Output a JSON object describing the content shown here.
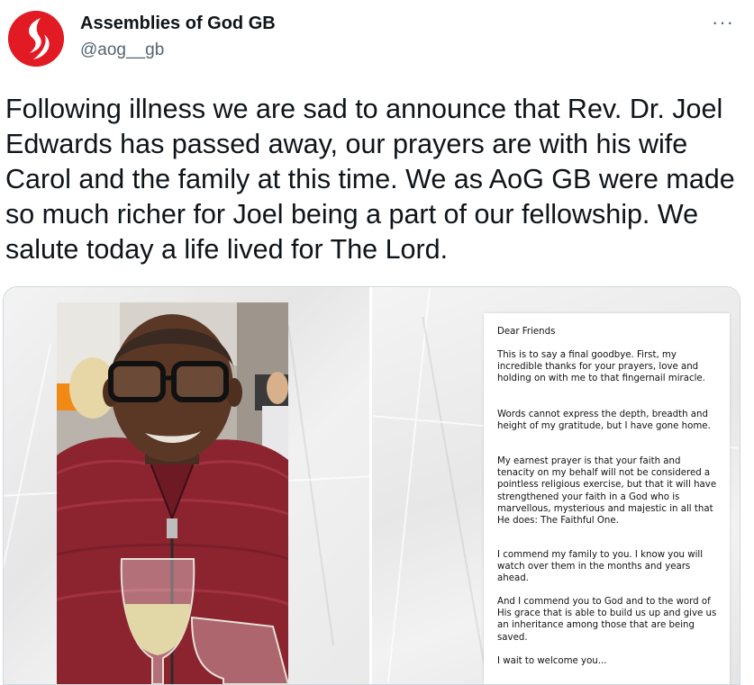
{
  "account": {
    "name": "Assemblies of God GB",
    "handle": "@aog__gb",
    "avatar_icon": "aog-flame-logo",
    "brand_color": "#e21a23"
  },
  "menu": {
    "more_label": "···",
    "icon": "more-dots-icon"
  },
  "tweet": {
    "text": "Following illness we are sad to announce that Rev. Dr. Joel Edwards has passed away, our prayers are with his wife Carol and the family at this time. We as AoG GB were made so much richer for Joel being a part of our fellowship. We salute today a life lived for The Lord."
  },
  "media": {
    "photo_icon": "portrait-photo",
    "letter": {
      "greeting": "Dear Friends",
      "paragraphs": [
        "This is to say a final goodbye. First, my incredible thanks for your prayers, love and holding on with me to that fingernail miracle.",
        "Words cannot express the depth, breadth and height of my gratitude, but I have gone home.",
        "My earnest prayer is that your faith and tenacity on my behalf will not be considered a pointless religious exercise, but that it will have strengthened your faith in a God who is marvellous, mysterious and majestic in all that He does: The Faithful One.",
        "I commend my family to you. I know you will watch over them in the months and years ahead.",
        "And I commend you to God and to the word of His grace that is able to build us up and give us an inheritance among those that are being saved.",
        "I wait to welcome you..."
      ]
    }
  }
}
